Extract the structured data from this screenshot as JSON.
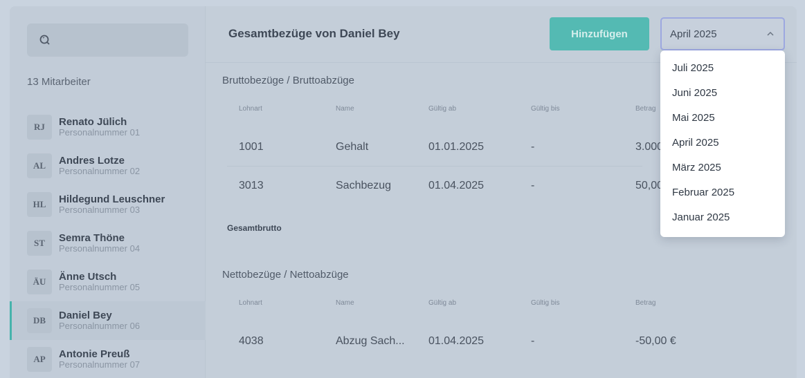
{
  "sidebar": {
    "count_label": "13 Mitarbeiter",
    "employees": [
      {
        "initials": "RJ",
        "name": "Renato Jülich",
        "id": "Personalnummer 01"
      },
      {
        "initials": "AL",
        "name": "Andres Lotze",
        "id": "Personalnummer 02"
      },
      {
        "initials": "HL",
        "name": "Hildegund Leuschner",
        "id": "Personalnummer 03"
      },
      {
        "initials": "ST",
        "name": "Semra Thöne",
        "id": "Personalnummer 04"
      },
      {
        "initials": "ÄU",
        "name": "Änne Utsch",
        "id": "Personalnummer 05"
      },
      {
        "initials": "DB",
        "name": "Daniel Bey",
        "id": "Personalnummer 06"
      },
      {
        "initials": "AP",
        "name": "Antonie Preuß",
        "id": "Personalnummer 07"
      }
    ],
    "active_index": 5
  },
  "header": {
    "title": "Gesamtbezüge von Daniel Bey",
    "add_label": "Hinzufügen",
    "selected_month": "April 2025"
  },
  "gross": {
    "title": "Bruttobezüge / Bruttoabzüge",
    "columns": [
      "Lohnart",
      "Name",
      "Gültig ab",
      "Gültig bis",
      "Betrag"
    ],
    "rows": [
      [
        "1001",
        "Gehalt",
        "01.01.2025",
        "-",
        "3.000"
      ],
      [
        "3013",
        "Sachbezug",
        "01.04.2025",
        "-",
        "50,00"
      ]
    ],
    "total_label": "Gesamtbrutto"
  },
  "net": {
    "title": "Nettobezüge / Nettoabzüge",
    "columns": [
      "Lohnart",
      "Name",
      "Gültig ab",
      "Gültig bis",
      "Betrag"
    ],
    "rows": [
      [
        "4038",
        "Abzug Sach...",
        "01.04.2025",
        "-",
        "-50,00 €"
      ]
    ]
  },
  "dropdown": {
    "options": [
      "Juli 2025",
      "Juni 2025",
      "Mai 2025",
      "April 2025",
      "März 2025",
      "Februar 2025",
      "Januar 2025"
    ]
  },
  "colors": {
    "accent": "#54bab3",
    "focus_border": "#9da8e0"
  }
}
